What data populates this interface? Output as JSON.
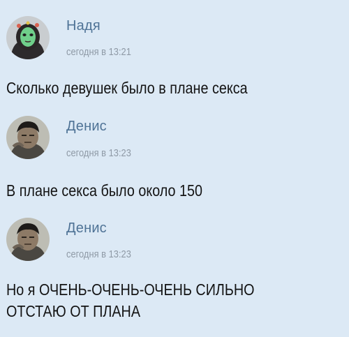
{
  "messages": [
    {
      "author": "Надя",
      "time": "сегодня в 13:21",
      "text_lines": [
        "Сколько девушек было в плане секса"
      ],
      "avatar_icon": "user-avatar-zombie-girl"
    },
    {
      "author": "Денис",
      "time": "сегодня в 13:23",
      "text_lines": [
        "В плане секса было около 150"
      ],
      "avatar_icon": "user-avatar-man"
    },
    {
      "author": "Денис",
      "time": "сегодня в 13:23",
      "text_lines": [
        "Но я ОЧЕНЬ-ОЧЕНЬ-ОЧЕНЬ СИЛЬНО",
        "ОТСТАЮ ОТ ПЛАНА"
      ],
      "avatar_icon": "user-avatar-man"
    }
  ],
  "colors": {
    "background": "#dce9f5",
    "author_name": "#4f7396",
    "timestamp": "#8f9aa6",
    "message_text": "#141414"
  }
}
